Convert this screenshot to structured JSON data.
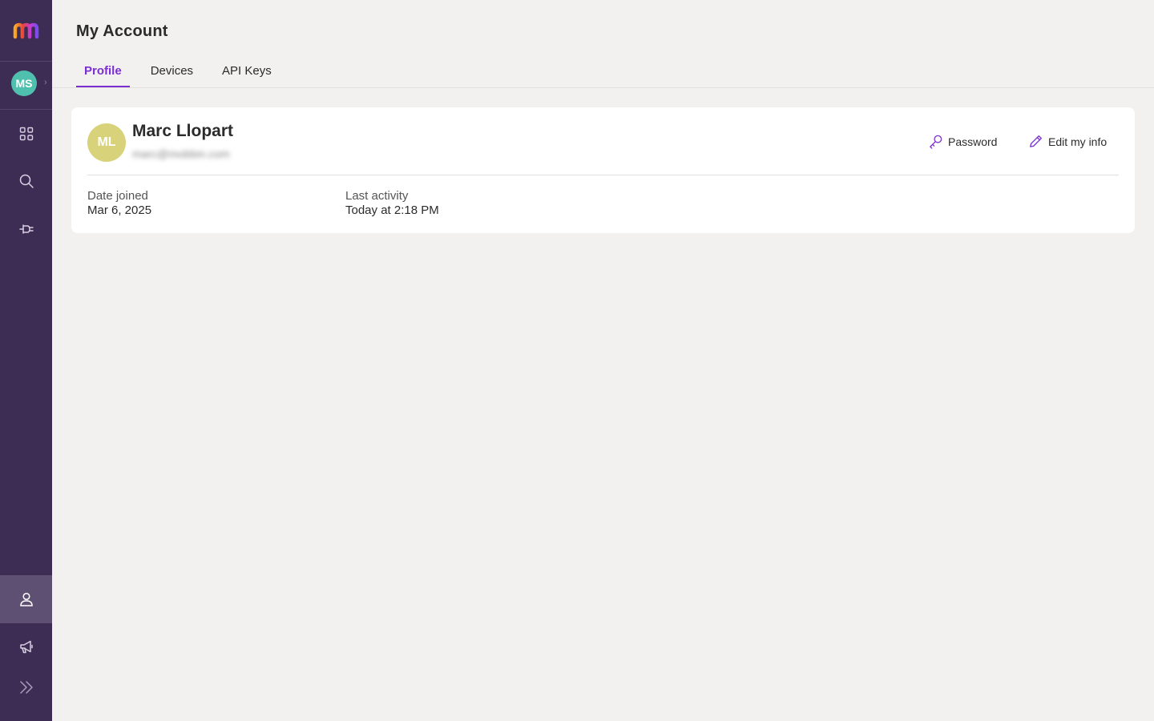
{
  "app": {
    "name": "Mobbin"
  },
  "sidebar": {
    "user_initials": "MS",
    "items": [
      {
        "name": "home",
        "icon": "grid-icon"
      },
      {
        "name": "search",
        "icon": "search-icon"
      },
      {
        "name": "integrations",
        "icon": "plug-icon"
      },
      {
        "name": "account",
        "icon": "user-icon",
        "active": true
      },
      {
        "name": "announcements",
        "icon": "megaphone-icon"
      },
      {
        "name": "expand",
        "icon": "double-chevron-right-icon"
      }
    ]
  },
  "header": {
    "title": "My Account"
  },
  "tabs": [
    {
      "label": "Profile",
      "active": true
    },
    {
      "label": "Devices",
      "active": false
    },
    {
      "label": "API Keys",
      "active": false
    }
  ],
  "profile": {
    "initials": "ML",
    "name": "Marc Llopart",
    "email": "marc@mobbin.com",
    "actions": {
      "password_label": "Password",
      "edit_label": "Edit my info"
    },
    "date_joined_label": "Date joined",
    "date_joined": "Mar 6, 2025",
    "last_activity_label": "Last activity",
    "last_activity": "Today at 2:18 PM"
  },
  "colors": {
    "sidebar_bg": "#3d2c54",
    "accent": "#7b2fd0",
    "user_avatar": "#4fbfae",
    "profile_avatar": "#d8d27a"
  }
}
